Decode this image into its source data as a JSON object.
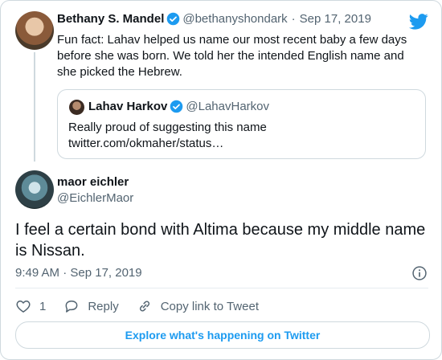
{
  "parent_tweet": {
    "author_name": "Bethany S. Mandel",
    "handle": "@bethanyshondark",
    "separator": "·",
    "date": "Sep 17, 2019",
    "text": "Fun fact: Lahav helped us name our most recent baby a few days before she was born. We told her the intended English name and she picked the Hebrew."
  },
  "quoted_tweet": {
    "author_name": "Lahav Harkov",
    "handle": "@LahavHarkov",
    "text_line1": "Really proud of suggesting this name",
    "text_line2": "twitter.com/okmaher/status…"
  },
  "main_tweet": {
    "author_name": "maor eichler",
    "handle": "@EichlerMaor",
    "text": "I feel a certain bond with Altima because my middle name is Nissan.",
    "timestamp": "9:49 AM · Sep 17, 2019"
  },
  "actions": {
    "like_count": "1",
    "reply_label": "Reply",
    "copy_link_label": "Copy link to Tweet"
  },
  "explore_label": "Explore what's happening on Twitter",
  "icons": {
    "brand": "twitter-bird-icon",
    "verified": "verified-badge-icon",
    "info": "info-icon",
    "like": "heart-icon",
    "reply": "reply-bubble-icon",
    "copy": "link-icon"
  },
  "colors": {
    "brand_blue": "#1d9bf0",
    "muted_text": "#536471",
    "border": "#cfd9de"
  }
}
